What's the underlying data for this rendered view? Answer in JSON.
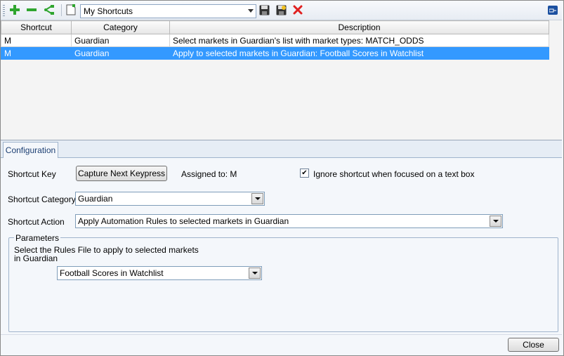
{
  "toolbar": {
    "icons": [
      "add-icon",
      "remove-icon",
      "duplicate-icon",
      "new-document-icon",
      "save-icon",
      "save-as-icon",
      "delete-icon",
      "pin-icon"
    ],
    "shortcut_set": "My Shortcuts"
  },
  "grid": {
    "columns": [
      "Shortcut",
      "Category",
      "Description"
    ],
    "rows": [
      {
        "shortcut": "M",
        "category": "Guardian",
        "description": "Select markets in Guardian's list with market types: MATCH_ODDS"
      },
      {
        "shortcut": "M",
        "category": "Guardian",
        "description": "Apply to selected markets in Guardian: Football Scores in Watchlist"
      }
    ],
    "selected_row": 1
  },
  "config": {
    "tab_label": "Configuration",
    "shortcut_key_label": "Shortcut Key",
    "capture_button": "Capture Next Keypress",
    "assigned_to": "Assigned to: M",
    "ignore_checkbox_label": "Ignore shortcut when focused on a text box",
    "ignore_checked": true,
    "category_label": "Shortcut Category",
    "category_value": "Guardian",
    "action_label": "Shortcut Action",
    "action_value": "Apply Automation Rules to selected markets in Guardian",
    "parameters_legend": "Parameters",
    "parameters_desc_line1": "Select the Rules File to apply to selected markets",
    "parameters_desc_line2": "in Guardian",
    "rules_file_value": "Football Scores in Watchlist"
  },
  "footer": {
    "close_button": "Close"
  },
  "colors": {
    "selection": "#3399ff",
    "add": "#2fa52f",
    "delete": "#e02020",
    "pin": "#1a4fa0"
  }
}
